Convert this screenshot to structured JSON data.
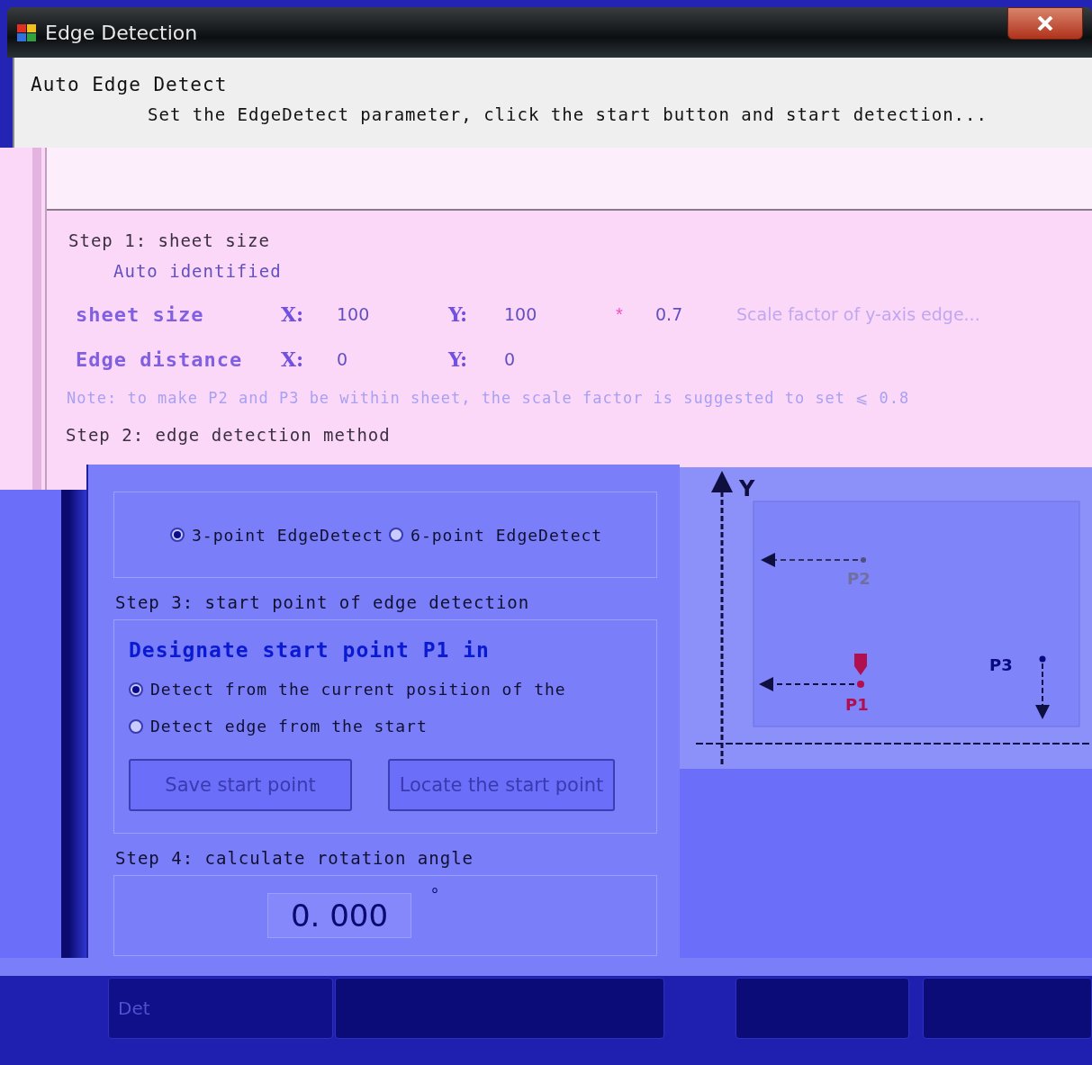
{
  "window": {
    "title": "Edge Detection"
  },
  "header": {
    "title": "Auto Edge Detect",
    "instruction": "Set the EdgeDetect parameter, click the start button and start detection..."
  },
  "step1": {
    "title": "Step 1: sheet size",
    "auto_identified": {
      "label": "Auto identified"
    },
    "rows": [
      {
        "label": "sheet size",
        "x_label": "X:",
        "x_value": "100",
        "y_label": "Y:",
        "y_value": "100"
      },
      {
        "label": "Edge distance",
        "x_label": "X:",
        "x_value": "0",
        "y_label": "Y:",
        "y_value": "0"
      }
    ],
    "scale": {
      "mark": "*",
      "value": "0.7",
      "hint": "Scale factor of y-axis edge..."
    },
    "note": "Note: to make P2 and P3 be within sheet, the scale factor is suggested to set ⩽ 0.8"
  },
  "step2": {
    "title": "Step 2: edge detection method",
    "options": [
      {
        "label": "3-point EdgeDetect",
        "selected": true
      },
      {
        "label": "6-point EdgeDetect",
        "selected": false
      }
    ]
  },
  "step3": {
    "title": "Step 3: start point of edge detection",
    "heading": "Designate start point P1 in",
    "options": [
      {
        "label": "Detect from the current position of the",
        "selected": true
      },
      {
        "label": "Detect edge from the start",
        "selected": false
      }
    ],
    "buttons": [
      "Save start point",
      "Locate the start point"
    ]
  },
  "step4": {
    "title": "Step 4: calculate rotation angle",
    "value": "0. 000",
    "unit": "°"
  },
  "diagram": {
    "y_axis": "Y",
    "points": [
      "P2",
      "P1",
      "P3"
    ]
  },
  "bottom_buttons": [
    {
      "label": "Det",
      "obscured": false
    },
    {
      "obscured": true
    },
    {
      "obscured": true
    },
    {
      "obscured": true
    }
  ]
}
